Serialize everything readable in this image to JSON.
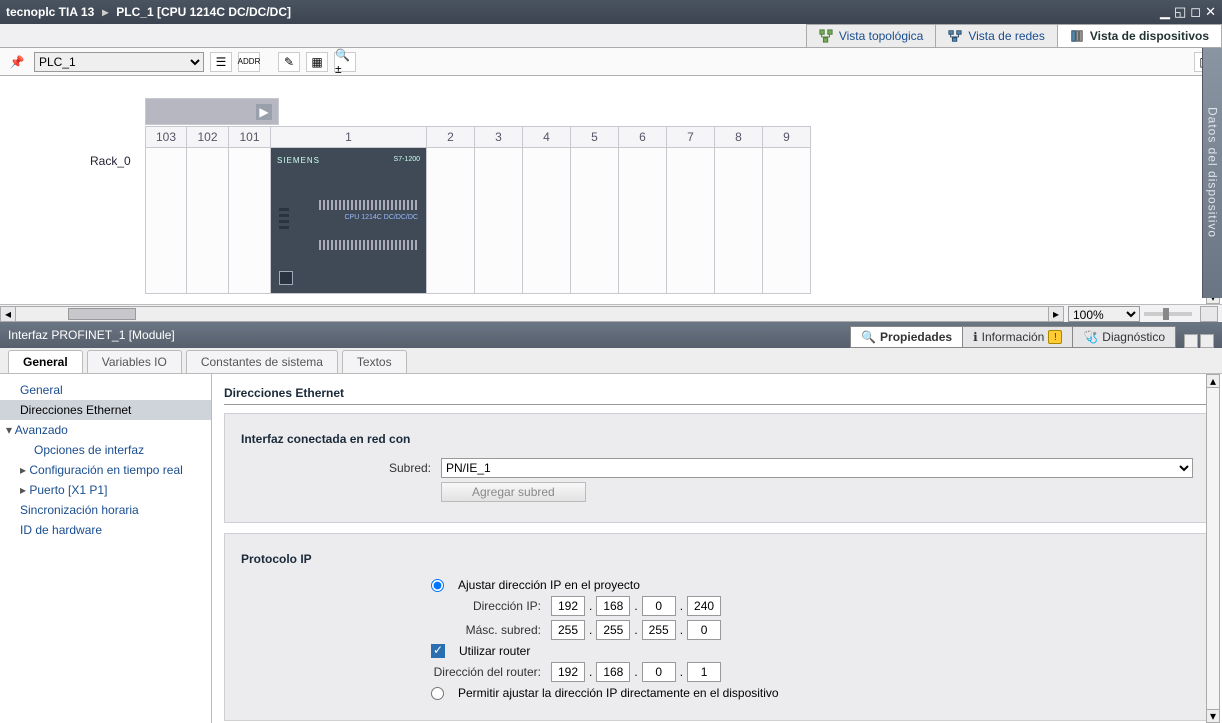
{
  "titlebar": {
    "crumb1": "tecnoplc TIA 13",
    "sep": "▸",
    "crumb2": "PLC_1 [CPU 1214C DC/DC/DC]"
  },
  "viewtabs": {
    "topo": "Vista topológica",
    "net": "Vista de redes",
    "dev": "Vista de dispositivos"
  },
  "toolbar": {
    "device_select": "PLC_1"
  },
  "rack": {
    "label": "Rack_0",
    "slots_left": [
      "103",
      "102",
      "101"
    ],
    "slot_cpu_hdr": "1",
    "slots_right": [
      "2",
      "3",
      "4",
      "5",
      "6",
      "7",
      "8",
      "9"
    ],
    "cpu_brand": "SIEMENS",
    "cpu_model": "S7-1200",
    "cpu_txt": "CPU 1214C\nDC/DC/DC"
  },
  "zoom": {
    "value": "100%"
  },
  "inspector": {
    "title": "Interfaz PROFINET_1 [Module]",
    "tabs": {
      "props": "Propiedades",
      "info": "Información",
      "diag": "Diagnóstico"
    }
  },
  "proptabs": {
    "general": "General",
    "vario": "Variables IO",
    "const": "Constantes de sistema",
    "text": "Textos"
  },
  "tree": {
    "general": "General",
    "eth": "Direcciones Ethernet",
    "adv": "Avanzado",
    "opt": "Opciones de interfaz",
    "rt": "Configuración en tiempo real",
    "port": "Puerto [X1 P1]",
    "sync": "Sincronización horaria",
    "hw": "ID de hardware"
  },
  "content": {
    "section": "Direcciones Ethernet",
    "sub1": "Interfaz conectada en red con",
    "subred_label": "Subred:",
    "subred_value": "PN/IE_1",
    "add_subnet": "Agregar subred",
    "sub2": "Protocolo IP",
    "radio_proj": "Ajustar dirección IP en el proyecto",
    "ip_label": "Dirección IP:",
    "ip": [
      "192",
      "168",
      "0",
      "240"
    ],
    "mask_label": "Másc. subred:",
    "mask": [
      "255",
      "255",
      "255",
      "0"
    ],
    "use_router": "Utilizar router",
    "router_label": "Dirección del router:",
    "router": [
      "192",
      "168",
      "0",
      "1"
    ],
    "radio_dev": "Permitir ajustar la dirección IP directamente en el dispositivo"
  },
  "sidebar_label": "Datos del dispositivo"
}
